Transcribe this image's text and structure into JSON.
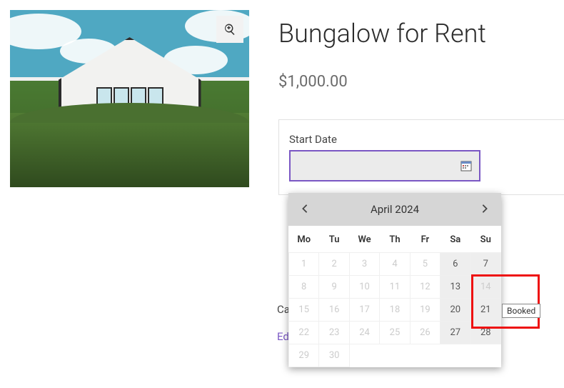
{
  "product": {
    "title": "Bungalow for Rent",
    "price": "$1,000.00"
  },
  "form": {
    "start_date_label": "Start Date"
  },
  "meta": {
    "category_prefix": "Cat",
    "edit_prefix": "Edi"
  },
  "calendar": {
    "month_label": "April 2024",
    "weekdays": [
      "Mo",
      "Tu",
      "We",
      "Th",
      "Fr",
      "Sa",
      "Su"
    ],
    "weeks": [
      [
        {
          "d": "1",
          "s": "dis"
        },
        {
          "d": "2",
          "s": "dis"
        },
        {
          "d": "3",
          "s": "dis"
        },
        {
          "d": "4",
          "s": "dis"
        },
        {
          "d": "5",
          "s": "dis"
        },
        {
          "d": "6",
          "s": "avail"
        },
        {
          "d": "7",
          "s": "avail"
        }
      ],
      [
        {
          "d": "8",
          "s": "dis"
        },
        {
          "d": "9",
          "s": "dis"
        },
        {
          "d": "10",
          "s": "dis"
        },
        {
          "d": "11",
          "s": "dis"
        },
        {
          "d": "12",
          "s": "dis"
        },
        {
          "d": "13",
          "s": "avail"
        },
        {
          "d": "14",
          "s": "booked"
        }
      ],
      [
        {
          "d": "15",
          "s": "dis"
        },
        {
          "d": "16",
          "s": "dis"
        },
        {
          "d": "17",
          "s": "dis"
        },
        {
          "d": "18",
          "s": "dis"
        },
        {
          "d": "19",
          "s": "dis"
        },
        {
          "d": "20",
          "s": "avail"
        },
        {
          "d": "21",
          "s": "avail"
        }
      ],
      [
        {
          "d": "22",
          "s": "dis"
        },
        {
          "d": "23",
          "s": "dis"
        },
        {
          "d": "24",
          "s": "dis"
        },
        {
          "d": "25",
          "s": "dis"
        },
        {
          "d": "26",
          "s": "dis"
        },
        {
          "d": "27",
          "s": "avail"
        },
        {
          "d": "28",
          "s": "avail"
        }
      ],
      [
        {
          "d": "29",
          "s": "dis"
        },
        {
          "d": "30",
          "s": "dis"
        },
        {
          "d": "",
          "s": "empty"
        },
        {
          "d": "",
          "s": "empty"
        },
        {
          "d": "",
          "s": "empty"
        },
        {
          "d": "",
          "s": "empty"
        },
        {
          "d": "",
          "s": "empty"
        }
      ]
    ]
  },
  "tooltip": {
    "text": "Booked"
  }
}
